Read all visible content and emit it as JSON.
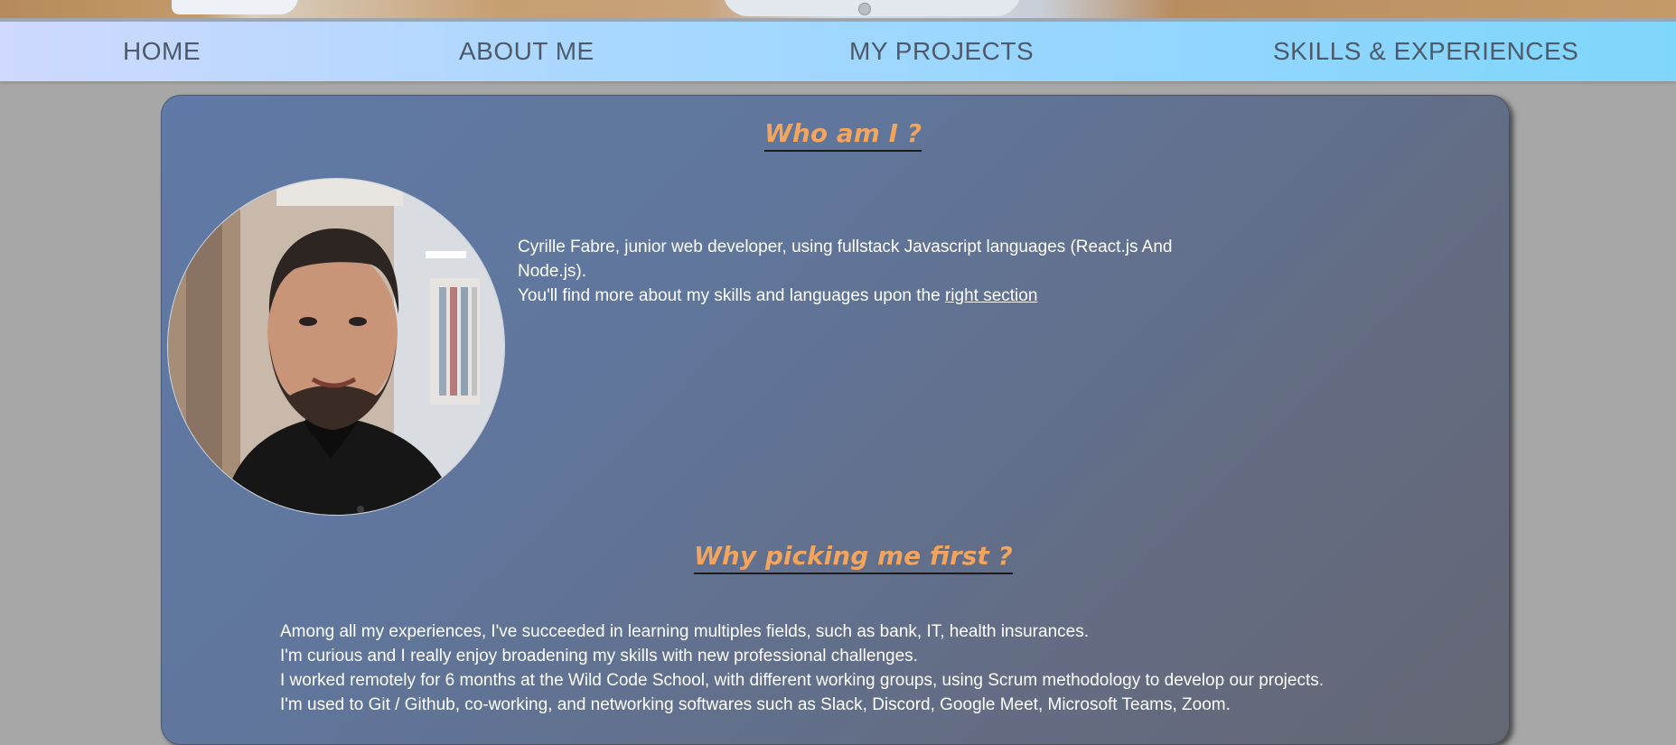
{
  "nav": {
    "items": [
      {
        "label": "HOME"
      },
      {
        "label": "ABOUT ME"
      },
      {
        "label": "MY PROJECTS"
      },
      {
        "label": "SKILLS & EXPERIENCES"
      }
    ]
  },
  "who": {
    "title": "Who am I ?",
    "intro_line1": "Cyrille Fabre, junior web developer, using fullstack Javascript languages (React.js And",
    "intro_line2": "Node.js).",
    "more_prefix": "You'll find more about my skills and languages upon the ",
    "more_link": "right section"
  },
  "why": {
    "title": "Why picking me first ?",
    "lines": [
      "Among all my experiences, I've succeeded in learning multiples fields, such as bank, IT, health insurances.",
      "I'm curious and I really enjoy broadening my skills with new professional challenges.",
      "I worked remotely for 6 months at the Wild Code School, with different working groups, using Scrum methodology to develop our projects.",
      "I'm used to Git / Github, co-working, and networking softwares such as Slack, Discord, Google Meet, Microsoft Teams, Zoom."
    ]
  },
  "colors": {
    "heading": "#f1a55f",
    "nav_text": "#4e5a6b",
    "card_start": "#5f7aa6",
    "card_end": "#646773"
  }
}
